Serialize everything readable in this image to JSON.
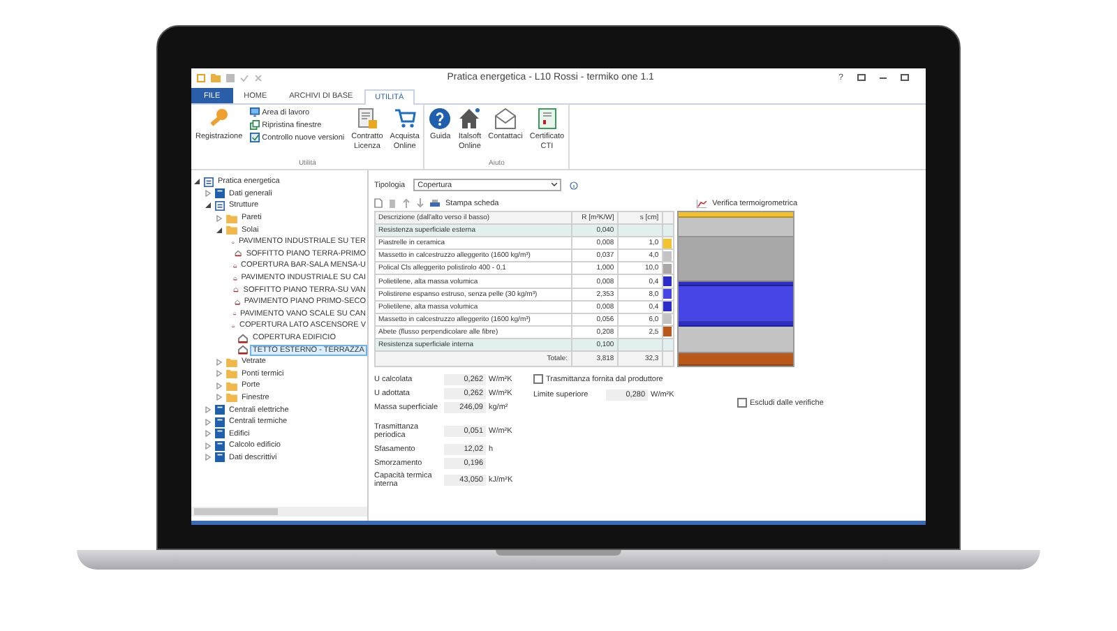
{
  "window": {
    "title": "Pratica energetica - L10 Rossi - termiko one 1.1",
    "help": "?"
  },
  "tabs": [
    {
      "label": "FILE",
      "kind": "file",
      "selected": false
    },
    {
      "label": "HOME",
      "kind": "tab",
      "selected": false
    },
    {
      "label": "ARCHIVI DI BASE",
      "kind": "tab",
      "selected": false
    },
    {
      "label": "UTILITÀ",
      "kind": "tab",
      "selected": true
    }
  ],
  "ribbon_groups": [
    {
      "label": "Utilità",
      "items": [
        {
          "kind": "large",
          "label": "Registrazione"
        },
        {
          "kind": "stack",
          "items": [
            {
              "label": "Area di lavoro"
            },
            {
              "label": "Ripristina finestre"
            },
            {
              "label": "Controllo nuove versioni"
            }
          ]
        },
        {
          "kind": "large",
          "label": "Contratto Licenza"
        },
        {
          "kind": "large",
          "label": "Acquista Online"
        }
      ]
    },
    {
      "label": "Aiuto",
      "items": [
        {
          "kind": "large",
          "label": "Guida"
        },
        {
          "kind": "large",
          "label": "Italsoft Online"
        },
        {
          "kind": "large",
          "label": "Contattaci"
        },
        {
          "kind": "large",
          "label": "Certificato CTI"
        }
      ]
    }
  ],
  "tree": [
    {
      "label": "Pratica energetica",
      "kind": "page",
      "expanded": true,
      "selected": false,
      "children": [
        {
          "label": "Dati generali",
          "kind": "book",
          "expanded": false,
          "selected": false
        },
        {
          "label": "Strutture",
          "kind": "page",
          "expanded": true,
          "selected": false,
          "children": [
            {
              "label": "Pareti",
              "kind": "folder",
              "expanded": false,
              "selected": false
            },
            {
              "label": "Solai",
              "kind": "folder",
              "expanded": true,
              "selected": false,
              "children": [
                {
                  "label": "PAVIMENTO INDUSTRIALE SU TER",
                  "kind": "layer",
                  "selected": false
                },
                {
                  "label": "SOFFITTO PIANO TERRA-PRIMO",
                  "kind": "layer",
                  "selected": false
                },
                {
                  "label": "COPERTURA BAR-SALA MENSA-U",
                  "kind": "layer",
                  "selected": false
                },
                {
                  "label": "PAVIMENTO INDUSTRIALE SU CAI",
                  "kind": "layer",
                  "selected": false
                },
                {
                  "label": "SOFFITTO PIANO TERRA-SU VAN",
                  "kind": "layer",
                  "selected": false
                },
                {
                  "label": "PAVIMENTO PIANO PRIMO-SECO",
                  "kind": "layer",
                  "selected": false
                },
                {
                  "label": "PAVIMENTO VANO SCALE SU CAN",
                  "kind": "layer",
                  "selected": false
                },
                {
                  "label": "COPERTURA LATO ASCENSORE V",
                  "kind": "layer",
                  "selected": false
                },
                {
                  "label": "COPERTURA EDIFICIO",
                  "kind": "layer",
                  "selected": false
                },
                {
                  "label": "TETTO ESTERNO - TERRAZZA",
                  "kind": "layer",
                  "selected": true
                }
              ]
            },
            {
              "label": "Vetrate",
              "kind": "folder",
              "expanded": false,
              "selected": false
            },
            {
              "label": "Ponti termici",
              "kind": "folder",
              "expanded": false,
              "selected": false
            },
            {
              "label": "Porte",
              "kind": "folder",
              "expanded": false,
              "selected": false
            },
            {
              "label": "Finestre",
              "kind": "folder",
              "expanded": false,
              "selected": false
            }
          ]
        },
        {
          "label": "Centrali elettriche",
          "kind": "book",
          "expanded": false,
          "selected": false
        },
        {
          "label": "Centrali termiche",
          "kind": "book",
          "expanded": false,
          "selected": false
        },
        {
          "label": "Edifici",
          "kind": "book",
          "expanded": false,
          "selected": false
        },
        {
          "label": "Calcolo edificio",
          "kind": "book",
          "expanded": false,
          "selected": false
        },
        {
          "label": "Dati descrittivi",
          "kind": "book",
          "expanded": false,
          "selected": false
        }
      ]
    }
  ],
  "tipologia": {
    "label": "Tipologia",
    "value": "Copertura"
  },
  "toolbar": {
    "print": "Stampa scheda",
    "check": "Verifica termoigrometrica"
  },
  "table": {
    "columns": [
      "Descrizione (dall'alto verso il basso)",
      "R [m²K/W]",
      "s [cm]"
    ],
    "rows": [
      {
        "kind": "surface",
        "description": "Resistenza superficiale esterna",
        "r": "0,040"
      },
      {
        "kind": "layer",
        "description": "Piastrelle in ceramica",
        "r": "0,008",
        "s": "1,0",
        "color": "#f2c230"
      },
      {
        "kind": "layer",
        "description": "Massetto in calcestruzzo alleggerito (1600 kg/m³)",
        "r": "0,037",
        "s": "4,0",
        "color": "#c4c4c4"
      },
      {
        "kind": "layer",
        "description": "Polical Cls alleggerito polistirolo 400 - 0,1",
        "r": "1,000",
        "s": "10,0",
        "color": "#a8a8a8"
      },
      {
        "kind": "layer",
        "description": "Polietilene, alta massa volumica",
        "r": "0,008",
        "s": "0,4",
        "color": "#2c2cc8"
      },
      {
        "kind": "layer",
        "description": "Polistirene espanso estruso, senza pelle (30 kg/m³)",
        "r": "2,353",
        "s": "8,0",
        "color": "#4646e6"
      },
      {
        "kind": "layer",
        "description": "Polietilene, alta massa volumica",
        "r": "0,008",
        "s": "0,4",
        "color": "#2c2cc8"
      },
      {
        "kind": "layer",
        "description": "Massetto in calcestruzzo alleggerito (1600 kg/m³)",
        "r": "0,056",
        "s": "6,0",
        "color": "#c4c4c4"
      },
      {
        "kind": "layer",
        "description": "Abete (flusso perpendicolare alle fibre)",
        "r": "0,208",
        "s": "2,5",
        "color": "#b8581a"
      },
      {
        "kind": "surface",
        "description": "Resistenza superficiale interna",
        "r": "0,100"
      }
    ],
    "total": {
      "label": "Totale:",
      "r": "3,818",
      "s": "32,3"
    }
  },
  "results": [
    {
      "label": "U calcolata",
      "value": "0,262",
      "unit": "W/m²K"
    },
    {
      "label": "U adottata",
      "value": "0,262",
      "unit": "W/m²K"
    },
    {
      "label": "Massa superficiale",
      "value": "246,09",
      "unit": "kg/m²"
    },
    {
      "label": "Trasmittanza periodica",
      "value": "0,051",
      "unit": "W/m²K"
    },
    {
      "label": "Sfasamento",
      "value": "12,02",
      "unit": "h"
    },
    {
      "label": "Smorzamento",
      "value": "0,196"
    },
    {
      "label": "Capacità termica interna",
      "value": "43,050",
      "unit": "kJ/m²K"
    }
  ],
  "producer_check": {
    "label": "Trasmittanza fornita dal produttore",
    "checked": false
  },
  "limit": {
    "label": "Limite superiore",
    "value": "0,280",
    "unit": "W/m²K"
  },
  "exclude_check": {
    "label": "Escludi dalle verifiche",
    "checked": false
  }
}
